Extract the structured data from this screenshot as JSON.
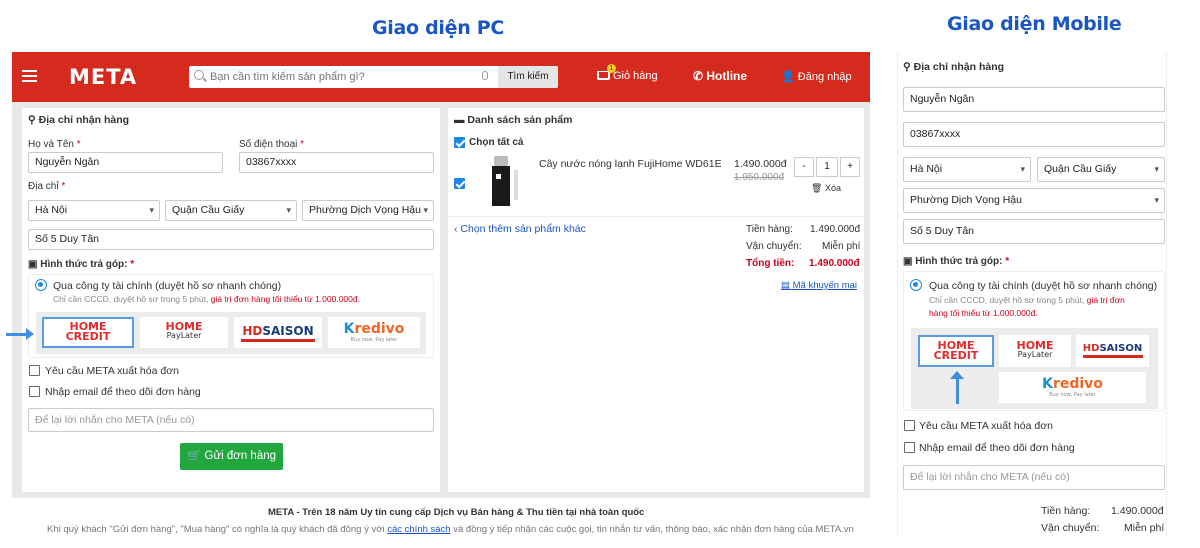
{
  "headings": {
    "pc": "Giao diện PC",
    "mobile": "Giao diện Mobile"
  },
  "header": {
    "logo": "META",
    "search_placeholder": "Bạn cần tìm kiếm sản phẩm gì?",
    "search_button": "Tìm kiếm",
    "cart_label": "Giỏ hàng",
    "cart_count": "1",
    "hotline": "Hotline",
    "login": "Đăng nhập"
  },
  "address": {
    "title": "Địa chỉ nhận hàng",
    "name_label": "Họ và Tên",
    "phone_label": "Số điện thoại",
    "name_value": "Nguyễn Ngân",
    "phone_value": "03867xxxx",
    "address_label": "Địa chỉ",
    "province": "Hà Nội",
    "district": "Quận Cầu Giấy",
    "ward": "Phường Dịch Vọng Hậu",
    "street": "Số 5 Duy Tân"
  },
  "installment": {
    "title": "Hình thức trả góp:",
    "option": "Qua công ty tài chính (duyệt hồ sơ nhanh chóng)",
    "note": "Chỉ cần CCCD, duyệt hồ sơ trong 5 phút, ",
    "note_red": "giá trị đơn hàng tối thiểu từ 1.000.000đ.",
    "mob_note_1": "Chỉ cần CCCD, duyệt hồ sơ trong 5 phút, ",
    "mob_note_red_1": "giá trị đơn",
    "mob_note_red_2": "hàng tối thiểu từ 1.000.000đ.",
    "providers": {
      "homecredit_1": "HOME",
      "homecredit_2": "CREDIT",
      "paylater_1": "HOME",
      "paylater_2": "PayLater",
      "hd": "HD",
      "saison": "SAISON",
      "kredivo_k": "K",
      "kredivo_rest": "redivo",
      "kredivo_tag": "Buy now, Pay later"
    }
  },
  "options": {
    "invoice": "Yêu cầu META xuất hóa đơn",
    "email": "Nhập email để theo dõi đơn hàng",
    "note_placeholder": "Để lại lời nhắn cho META (nếu có)"
  },
  "submit_label": "Gửi đơn hàng",
  "products": {
    "title": "Danh sách sản phẩm",
    "select_all": "Chọn tất cả",
    "item_name": "Cây nước nóng lạnh FujiHome WD61E",
    "price": "1.490.000đ",
    "old_price": "1.950.000đ",
    "qty": "1",
    "minus": "-",
    "plus": "+",
    "remove": "Xóa",
    "more_link": "‹ Chọn thêm sản phẩm khác"
  },
  "summary": {
    "subtotal_label": "Tiền hàng:",
    "subtotal": "1.490.000đ",
    "shipping_label": "Vận chuyển:",
    "shipping": "Miễn phí",
    "total_label": "Tổng tiền:",
    "total": "1.490.000đ",
    "promo": "Mã khuyến mại"
  },
  "footer": {
    "line1": "META - Trên 18 năm Uy tín cung cấp Dịch vụ Bán hàng & Thu tiền tại nhà toàn quốc",
    "line2_a": "Khi quý khách \"Gửi đơn hàng\", \"Mua hàng\" có nghĩa là quý khách đã đồng ý với ",
    "line2_link": "các chính sách",
    "line2_b": " và đồng ý tiếp nhận các cuộc gọi, tin nhắn tư vấn, thông báo, xác nhận đơn hàng của META.vn"
  },
  "colors": {
    "header_red": "#d52b1e",
    "accent_blue": "#1e88e5",
    "submit_green": "#22a73e",
    "total_red": "#d0021b"
  }
}
